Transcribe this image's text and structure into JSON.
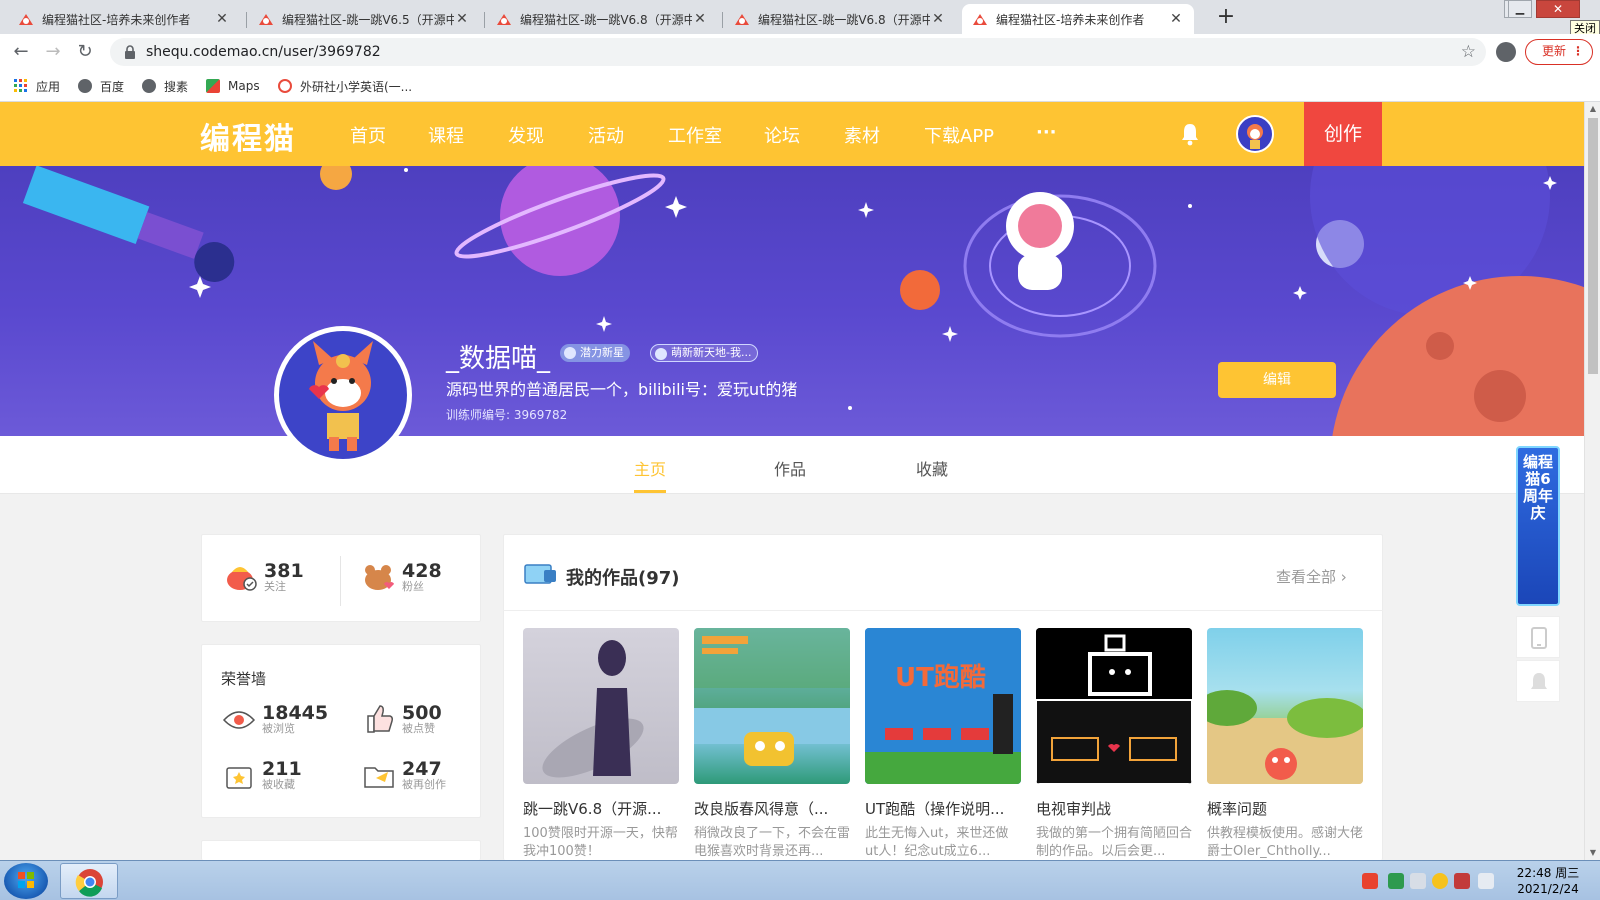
{
  "browser": {
    "tabs": [
      {
        "title": "编程猫社区-培养未来创作者",
        "active": false
      },
      {
        "title": "编程猫社区-跳一跳V6.5（开源中",
        "active": false
      },
      {
        "title": "编程猫社区-跳一跳V6.8（开源中",
        "active": false
      },
      {
        "title": "编程猫社区-跳一跳V6.8（开源中",
        "active": false
      },
      {
        "title": "编程猫社区-培养未来创作者",
        "active": true
      }
    ],
    "url": "shequ.codemao.cn/user/3969782",
    "update_label": "更新",
    "close_tooltip": "关闭",
    "bookmarks": [
      {
        "label": "应用",
        "icon": "apps-grid-icon"
      },
      {
        "label": "百度",
        "icon": "globe-icon"
      },
      {
        "label": "搜素",
        "icon": "globe-icon"
      },
      {
        "label": "Maps",
        "icon": "maps-icon"
      },
      {
        "label": "外研社小学英语(一...",
        "icon": "site-icon"
      }
    ]
  },
  "site": {
    "logo": "编程猫",
    "nav": [
      "首页",
      "课程",
      "发现",
      "活动",
      "工作室",
      "论坛",
      "素材",
      "下载APP",
      "···"
    ],
    "create_label": "创作",
    "brand_color": "#fec433",
    "create_color": "#f0473f"
  },
  "profile": {
    "username": "_数据喵_",
    "badge_potential": "潜力新星",
    "badge_cute": "萌新新天地-我...",
    "bio": "源码世界的普通居民一个，bilibili号：爱玩ut的猪",
    "trainer_id": "训练师编号: 3969782",
    "edit_label": "编辑",
    "tabs": [
      "主页",
      "作品",
      "收藏"
    ],
    "active_tab": "主页"
  },
  "stats": {
    "following": {
      "value": "381",
      "label": "关注"
    },
    "fans": {
      "value": "428",
      "label": "粉丝"
    }
  },
  "honor": {
    "title": "荣誉墙",
    "items": [
      {
        "value": "18445",
        "label": "被浏览"
      },
      {
        "value": "500",
        "label": "被点赞"
      },
      {
        "value": "211",
        "label": "被收藏"
      },
      {
        "value": "247",
        "label": "被再创作"
      }
    ]
  },
  "works": {
    "title": "我的作品(97)",
    "view_all": "查看全部",
    "items": [
      {
        "title": "跳一跳V6.8（开源...",
        "desc": "100赞限时开源一天，快帮我冲100赞！"
      },
      {
        "title": "改良版春风得意（...",
        "desc": "稍微改良了一下，不会在雷电猴喜欢时背景还再..."
      },
      {
        "title": "UT跑酷（操作说明...",
        "desc": "此生无悔入ut，来世还做ut人！纪念ut成立6..."
      },
      {
        "title": "电视审判战",
        "desc": "我做的第一个拥有简陋回合制的作品。以后会更..."
      },
      {
        "title": "概率问题",
        "desc": "供教程模板使用。感谢大佬爵士Oler_Chtholly..."
      }
    ]
  },
  "side_ad": "编程猫6周年庆",
  "taskbar": {
    "time": "22:48 周三",
    "date": "2021/2/24"
  }
}
